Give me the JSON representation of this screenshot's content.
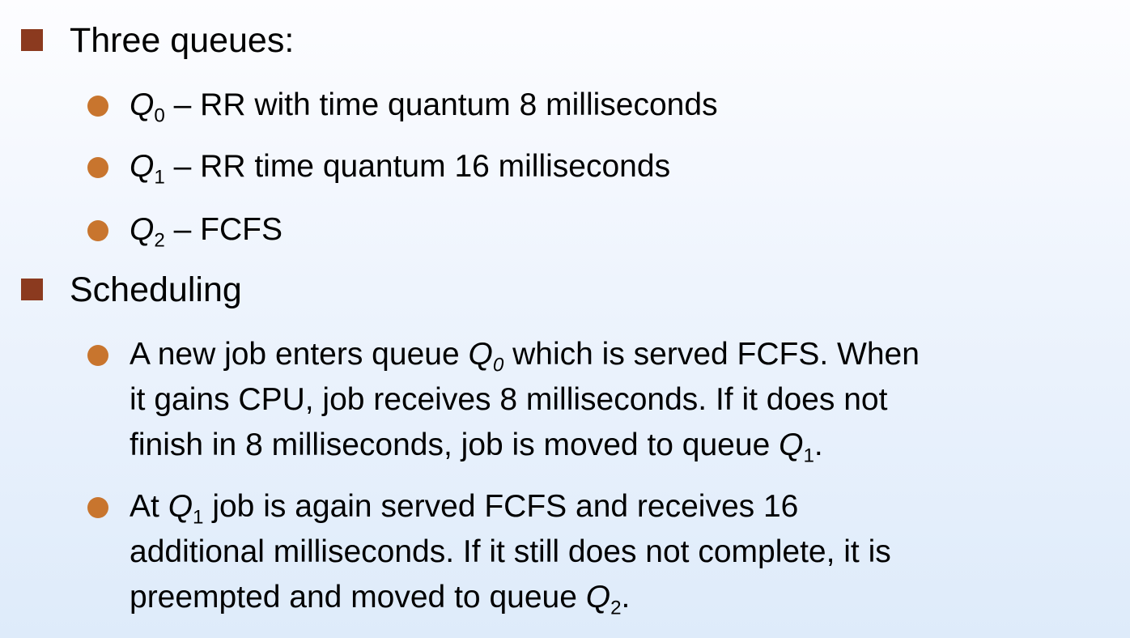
{
  "slide": {
    "bullets": [
      {
        "text": "Three queues:",
        "sub_items": [
          {
            "queue_letter": "Q",
            "queue_index": "0",
            "text": " – RR with time quantum 8 milliseconds"
          },
          {
            "queue_letter": "Q",
            "queue_index": "1",
            "text": " – RR time quantum 16 milliseconds"
          },
          {
            "queue_letter": "Q",
            "queue_index": "2",
            "text": " – FCFS"
          }
        ]
      },
      {
        "text": "Scheduling",
        "sub_items": [
          {
            "line1_pre": "A new job enters queue ",
            "line1_q": "Q",
            "line1_q_index": "0",
            "line1_post": " which is served FCFS. When",
            "line2": "it gains CPU, job receives 8 milliseconds.  If it does not",
            "line3_pre": "finish in 8 milliseconds, job is moved to queue ",
            "line3_q": "Q",
            "line3_q_index": "1",
            "line3_post": "."
          },
          {
            "line1_pre": "At ",
            "line1_q": "Q",
            "line1_q_index": "1",
            "line1_post": " job is again served FCFS and receives 16",
            "line2": "additional milliseconds.  If it still does not complete, it is",
            "line3_pre": "preempted and moved to queue ",
            "line3_q": "Q",
            "line3_q_index": "2",
            "line3_post": "."
          }
        ]
      }
    ]
  },
  "colors": {
    "square_bullet": "#8b3a1f",
    "round_bullet": "#c8752e",
    "background_top": "#fdfdff",
    "background_bottom": "#deebfa"
  }
}
